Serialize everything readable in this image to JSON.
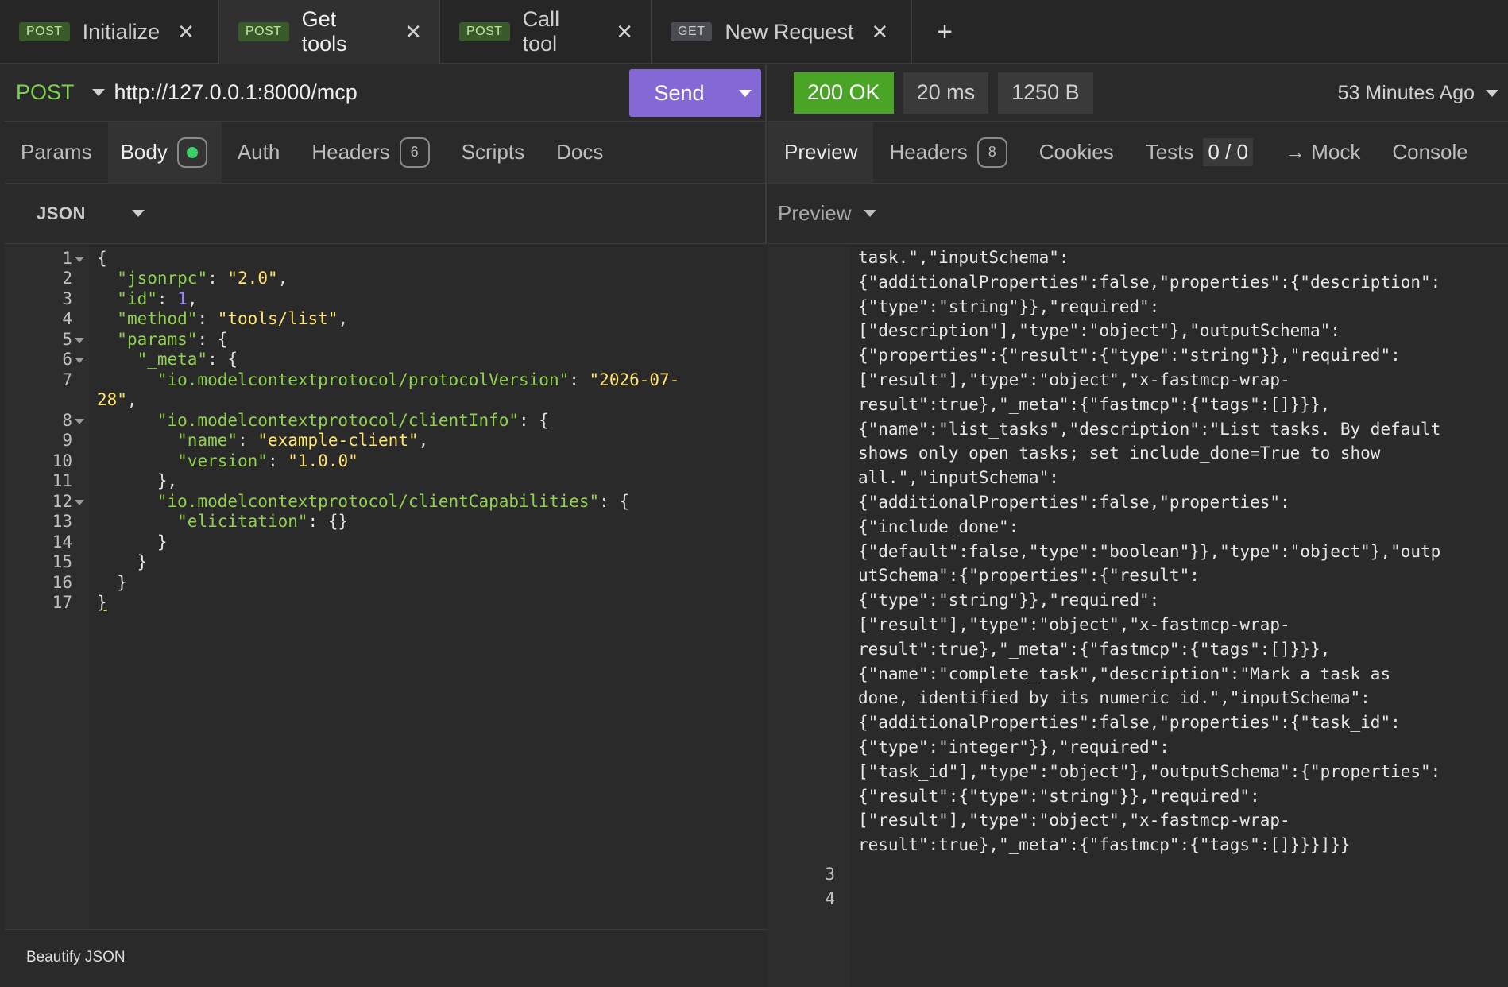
{
  "tabs": [
    {
      "method": "POST",
      "name": "Initialize"
    },
    {
      "method": "POST",
      "name": "Get tools"
    },
    {
      "method": "POST",
      "name": "Call tool"
    },
    {
      "method": "GET",
      "name": "New Request"
    }
  ],
  "tab_close_glyph": "✕",
  "add_tab_glyph": "+",
  "request": {
    "method": "POST",
    "url": "http://127.0.0.1:8000/mcp",
    "send_label": "Send"
  },
  "request_tabs": {
    "params": "Params",
    "body": "Body",
    "auth": "Auth",
    "headers": "Headers",
    "headers_count": "6",
    "scripts": "Scripts",
    "docs": "Docs"
  },
  "body_type": "JSON",
  "line_numbers": [
    "1",
    "2",
    "3",
    "4",
    "5",
    "6",
    "7",
    "",
    "8",
    "9",
    "10",
    "11",
    "12",
    "13",
    "14",
    "15",
    "16",
    "17"
  ],
  "code": {
    "l1_brace": "{",
    "l2_key": "\"jsonrpc\"",
    "l2_val": "\"2.0\"",
    "l3_key": "\"id\"",
    "l3_val": "1",
    "l4_key": "\"method\"",
    "l4_val": "\"tools/list\"",
    "l5_key": "\"params\"",
    "l6_key": "\"_meta\"",
    "l7_key": "\"io.modelcontextprotocol/protocolVersion\"",
    "l7_val_a": "\"2026-07-",
    "l7_val_b": "28\"",
    "l8_key": "\"io.modelcontextprotocol/clientInfo\"",
    "l9_key": "\"name\"",
    "l9_val": "\"example-client\"",
    "l10_key": "\"version\"",
    "l10_val": "\"1.0.0\"",
    "l11": "},",
    "l12_key": "\"io.modelcontextprotocol/clientCapabilities\"",
    "l13_key": "\"elicitation\"",
    "l13_val": "{}",
    "l14": "}",
    "l15": "}",
    "l16": "}",
    "l17": "}"
  },
  "beautify_label": "Beautify JSON",
  "response": {
    "status": "200 OK",
    "time": "20 ms",
    "size": "1250 B",
    "time_ago": "53 Minutes Ago"
  },
  "response_tabs": {
    "preview": "Preview",
    "headers": "Headers",
    "headers_count": "8",
    "cookies": "Cookies",
    "tests": "Tests",
    "tests_value": "0 / 0",
    "mock": "→ Mock",
    "console": "Console"
  },
  "preview_type": "Preview",
  "preview_lines": [
    "task.\",\"inputSchema\":",
    "{\"additionalProperties\":false,\"properties\":{\"description\":",
    "{\"type\":\"string\"}},\"required\":",
    "[\"description\"],\"type\":\"object\"},\"outputSchema\":",
    "{\"properties\":{\"result\":{\"type\":\"string\"}},\"required\":",
    "[\"result\"],\"type\":\"object\",\"x-fastmcp-wrap-",
    "result\":true},\"_meta\":{\"fastmcp\":{\"tags\":[]}}},",
    "{\"name\":\"list_tasks\",\"description\":\"List tasks. By default",
    "shows only open tasks; set include_done=True to show",
    "all.\",\"inputSchema\":",
    "{\"additionalProperties\":false,\"properties\":",
    "{\"include_done\":",
    "{\"default\":false,\"type\":\"boolean\"}},\"type\":\"object\"},\"outp",
    "utSchema\":{\"properties\":{\"result\":",
    "{\"type\":\"string\"}},\"required\":",
    "[\"result\"],\"type\":\"object\",\"x-fastmcp-wrap-",
    "result\":true},\"_meta\":{\"fastmcp\":{\"tags\":[]}}},",
    "{\"name\":\"complete_task\",\"description\":\"Mark a task as",
    "done, identified by its numeric id.\",\"inputSchema\":",
    "{\"additionalProperties\":false,\"properties\":{\"task_id\":",
    "{\"type\":\"integer\"}},\"required\":",
    "[\"task_id\"],\"type\":\"object\"},\"outputSchema\":{\"properties\":",
    "{\"result\":{\"type\":\"string\"}},\"required\":",
    "[\"result\"],\"type\":\"object\",\"x-fastmcp-wrap-",
    "result\":true},\"_meta\":{\"fastmcp\":{\"tags\":[]}}}]}}"
  ],
  "preview_line_numbers": [
    "3",
    "4"
  ],
  "colors": {
    "accent_send": "#8469d6",
    "status_ok": "#4aa526",
    "method_post": "#7bd34b",
    "json_key": "#8fd14f",
    "json_string": "#ffe36e",
    "json_number": "#9a8cff"
  },
  "icons": {
    "tab_close": "close-icon",
    "add_tab": "plus-icon",
    "dropdown": "caret-down-icon",
    "body_status": "green-dot-icon"
  }
}
